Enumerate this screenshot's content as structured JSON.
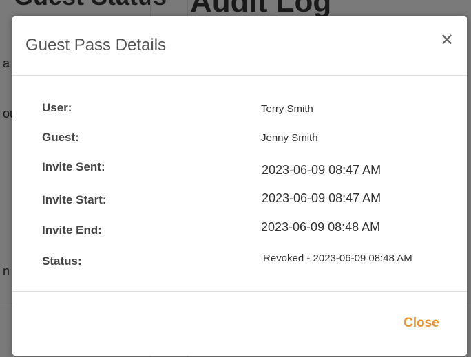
{
  "background": {
    "heading_left": "Guest Status",
    "heading": "Audit Log",
    "side_chars": [
      "a",
      "ou",
      "n"
    ]
  },
  "modal": {
    "title": "Guest Pass Details",
    "close_icon": "close-icon",
    "rows": [
      {
        "label": "User:",
        "value": "Terry Smith"
      },
      {
        "label": "Guest:",
        "value": "Jenny Smith"
      },
      {
        "label": "Invite Sent:",
        "value": "2023-06-09 08:47 AM"
      },
      {
        "label": "Invite Start:",
        "value": "2023-06-09 08:47 AM"
      },
      {
        "label": "Invite End:",
        "value": "2023-06-09 08:48 AM"
      },
      {
        "label": "Status:",
        "value": "Revoked - 2023-06-09 08:48 AM"
      }
    ],
    "close_label": "Close"
  },
  "colors": {
    "accent": "#f0922b",
    "overlay": "#7a7a7a"
  }
}
